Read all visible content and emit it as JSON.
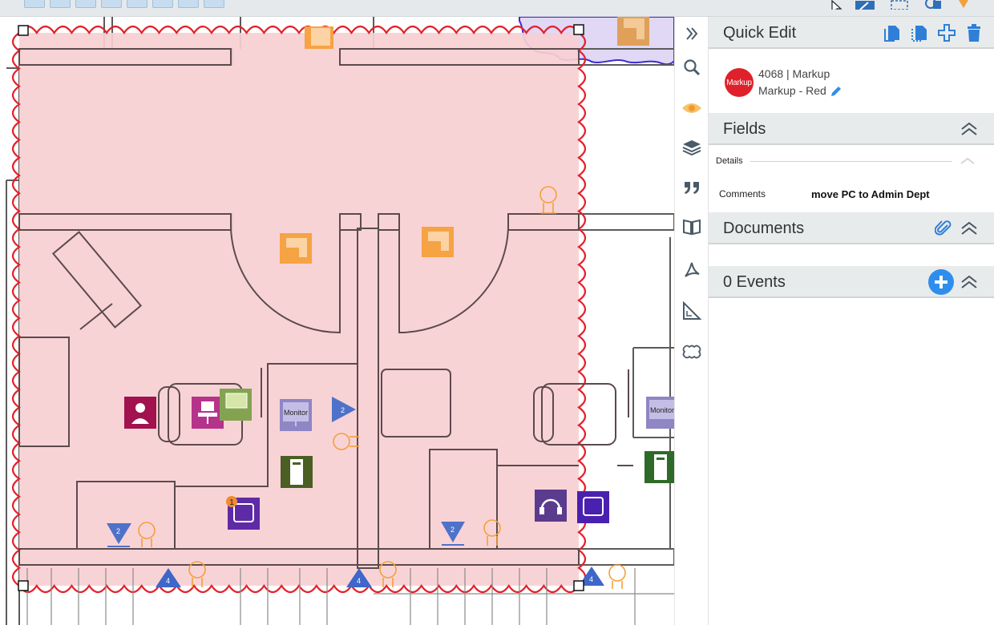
{
  "quick_edit": {
    "title": "Quick Edit",
    "actions": [
      "copy-icon",
      "paste-icon",
      "add-icon",
      "delete-icon"
    ]
  },
  "record": {
    "avatar_text": "Markup",
    "avatar_color": "#e0202a",
    "id_line": "4068 | Markup",
    "name_line": "Markup - Red"
  },
  "fields": {
    "title": "Fields",
    "group_label": "Details",
    "comments_label": "Comments",
    "comments_value": "move PC to Admin Dept"
  },
  "documents": {
    "title": "Documents"
  },
  "events": {
    "title": "0 Events"
  },
  "floorplan": {
    "monitor_label": "Monitor",
    "badge_count": "1",
    "chair_marker": "2",
    "outlet_marker": "4"
  },
  "toolbar": {
    "items": [
      "expand-icon",
      "search-icon",
      "eye-icon",
      "layers-icon",
      "quote-icon",
      "book-icon",
      "pdf-icon",
      "measure-icon",
      "cloud-markup-icon"
    ]
  },
  "colors": {
    "markup_fill": "#f7cfd2",
    "markup_stroke": "#e5202a",
    "accent_blue": "#2f8ded",
    "header_bg": "#e8ebec"
  }
}
